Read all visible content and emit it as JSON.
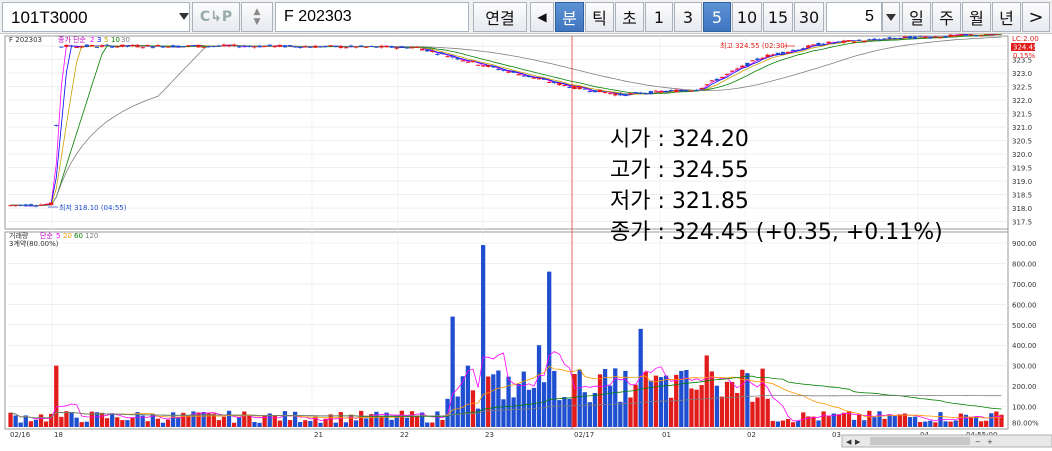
{
  "toolbar": {
    "code_value": "101T3000",
    "search_label": "F  202303",
    "connect_label": "연결",
    "period_tabs": [
      "분",
      "틱",
      "초"
    ],
    "interval_buttons": [
      "1",
      "3",
      "5",
      "10",
      "15",
      "30"
    ],
    "active_interval": "5",
    "count_value": "5",
    "range_tabs": [
      "일",
      "주",
      "월",
      "년"
    ]
  },
  "price_legend": {
    "symbol": "F 202303",
    "ma_label": "종가 단순",
    "ma_periods": [
      "2",
      "3",
      "5",
      "10",
      "30"
    ],
    "ma_colors": [
      "#ff00ff",
      "#0000ff",
      "#c8a000",
      "#008000",
      "#808080"
    ]
  },
  "volume_legend": {
    "name": "거래량",
    "ma_label": "단순",
    "ma_periods": [
      "5",
      "20",
      "60",
      "120"
    ],
    "ma_colors": [
      "#ff00ff",
      "#ff9900",
      "#008000",
      "#808080"
    ],
    "sub_label": "3계약(80.00%)"
  },
  "annotations": {
    "high": "최고 324.55 (02:30)",
    "low": "최저 318.10 (04:55)",
    "last_price": "324.45",
    "last_pct": "0.15%",
    "lc": "LC:2.00"
  },
  "price_axis": [
    "324.0",
    "323.5",
    "323.0",
    "322.5",
    "322.0",
    "321.5",
    "321.0",
    "320.5",
    "320.0",
    "319.5",
    "319.0",
    "318.5",
    "318.0",
    "317.5"
  ],
  "volume_axis": [
    "900.00",
    "800.00",
    "700.00",
    "600.00",
    "500.00",
    "400.00",
    "300.00",
    "200.00",
    "100.00",
    "80.00%"
  ],
  "x_labels": [
    "02/16",
    "18",
    "21",
    "22",
    "23",
    "02/17",
    "01",
    "02",
    "03",
    "04",
    "04:55:00"
  ],
  "info": {
    "open_label": "시가",
    "open_value": "324.20",
    "high_label": "고가",
    "high_value": "324.55",
    "low_label": "저가",
    "low_value": "321.85",
    "close_label": "종가",
    "close_value": "324.45",
    "change": "(+0.35,  +0.11%)"
  },
  "colors": {
    "up": "#e21b1b",
    "down": "#1f4fd0",
    "accent": "#3f76c0",
    "crosshair": "#e04040"
  }
}
